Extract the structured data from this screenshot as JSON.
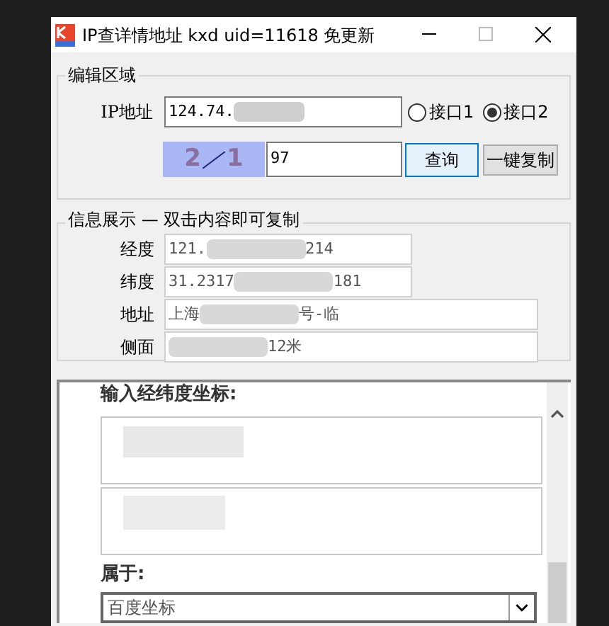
{
  "window": {
    "title": "IP查详情地址 kxd uid=11618 免更新"
  },
  "edit_group": {
    "title": "编辑区域",
    "ip_label": "IP地址",
    "ip_value": "124.74.",
    "interfaces": [
      {
        "label": "接口1",
        "selected": false
      },
      {
        "label": "接口2",
        "selected": true
      }
    ],
    "captcha": {
      "chars": [
        "2",
        "1"
      ]
    },
    "captcha_value": "97",
    "query_button": "查询",
    "copy_button": "一键复制"
  },
  "info_group": {
    "title": "信息展示 — 双击内容即可复制",
    "rows": [
      {
        "label": "经度",
        "prefix": "121.",
        "suffix": "214"
      },
      {
        "label": "纬度",
        "prefix": "31.2317",
        "suffix": "181"
      },
      {
        "label": "地址",
        "prefix": "上海",
        "suffix": "号-临"
      },
      {
        "label": "侧面",
        "prefix": "",
        "suffix": "12米"
      }
    ]
  },
  "web_panel": {
    "heading": "输入经纬度坐标:",
    "belongs_label": "属于:",
    "select_value": "百度坐标"
  }
}
